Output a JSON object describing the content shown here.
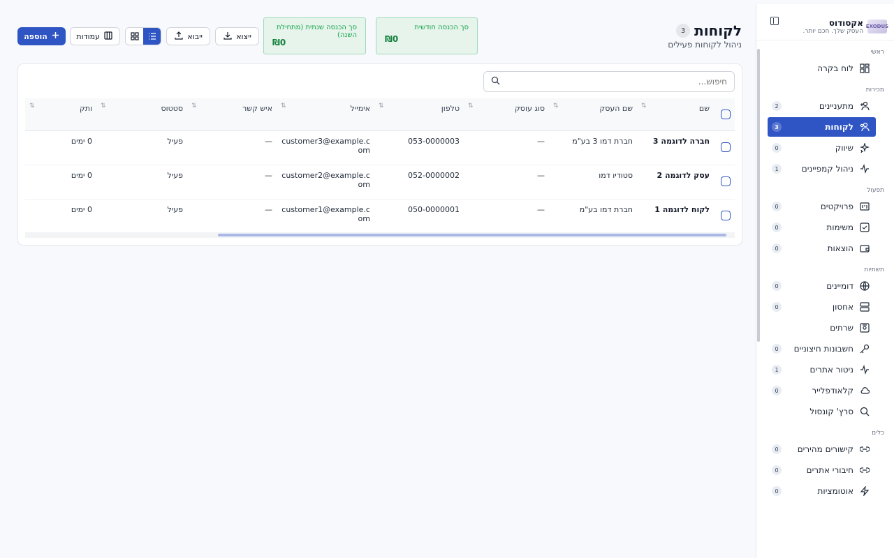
{
  "sidebar": {
    "brand_name": "אקסודוס",
    "brand_tagline": "העסק שלך. חכם יותר.",
    "logo_text": "EXODUS",
    "sections": {
      "main": "ראשי",
      "sales": "מכירות",
      "ops": "תפעול",
      "infra": "תשתיות",
      "tools": "כלים"
    },
    "items": [
      {
        "label": "לוח בקרה",
        "badge": ""
      },
      {
        "label": "מתעניינים",
        "badge": "2"
      },
      {
        "label": "לקוחות",
        "badge": "3"
      },
      {
        "label": "שיווק",
        "badge": "0"
      },
      {
        "label": "ניהול קמפיינים",
        "badge": "1"
      },
      {
        "label": "פרויקטים",
        "badge": "0"
      },
      {
        "label": "משימות",
        "badge": "0"
      },
      {
        "label": "הוצאות",
        "badge": "0"
      },
      {
        "label": "דומיינים",
        "badge": "0"
      },
      {
        "label": "אחסון",
        "badge": "0"
      },
      {
        "label": "שרתים",
        "badge": ""
      },
      {
        "label": "חשבונות חיצוניים",
        "badge": "0"
      },
      {
        "label": "ניטור אתרים",
        "badge": "1"
      },
      {
        "label": "קלאודפלייר",
        "badge": "0"
      },
      {
        "label": "סרץ' קונסול",
        "badge": ""
      },
      {
        "label": "קישורים מהירים",
        "badge": "0"
      },
      {
        "label": "חיבורי אתרים",
        "badge": "0"
      },
      {
        "label": "אוטומציות",
        "badge": "0"
      }
    ]
  },
  "header": {
    "title": "לקוחות",
    "count": "3",
    "subtitle": "ניהול לקוחות פעילים"
  },
  "stats": {
    "monthly_label": "סך הכנסה חודשית",
    "monthly_value": "₪0",
    "yearly_label": "סך הכנסה שנתית (מתחילת השנה)",
    "yearly_value": "₪0"
  },
  "toolbar": {
    "export": "ייצוא",
    "import": "ייבוא",
    "columns": "עמודות",
    "add": "הוספה"
  },
  "search": {
    "placeholder": "חיפוש..."
  },
  "table": {
    "headers": [
      "שם",
      "שם העסק",
      "סוג עוסק",
      "טלפון",
      "אימייל",
      "איש קשר",
      "סטטוס",
      "ותק"
    ],
    "rows": [
      {
        "name": "חברה לדוגמה 3",
        "business": "חברת דמו 3 בע\"מ",
        "type": "—",
        "phone": "053-0000003",
        "email": "customer3@example.com",
        "contact": "—",
        "status": "פעיל",
        "tenure": "0 ימים"
      },
      {
        "name": "עסק לדוגמה 2",
        "business": "סטודיו דמו",
        "type": "—",
        "phone": "052-0000002",
        "email": "customer2@example.com",
        "contact": "—",
        "status": "פעיל",
        "tenure": "0 ימים"
      },
      {
        "name": "לקוח לדוגמה 1",
        "business": "חברת דמו בע\"מ",
        "type": "—",
        "phone": "050-0000001",
        "email": "customer1@example.com",
        "contact": "—",
        "status": "פעיל",
        "tenure": "0 ימים"
      }
    ]
  },
  "colors": {
    "accent": "#2f55c4",
    "stat_bg": "#e6f4ec",
    "stat_text": "#16a34a"
  }
}
